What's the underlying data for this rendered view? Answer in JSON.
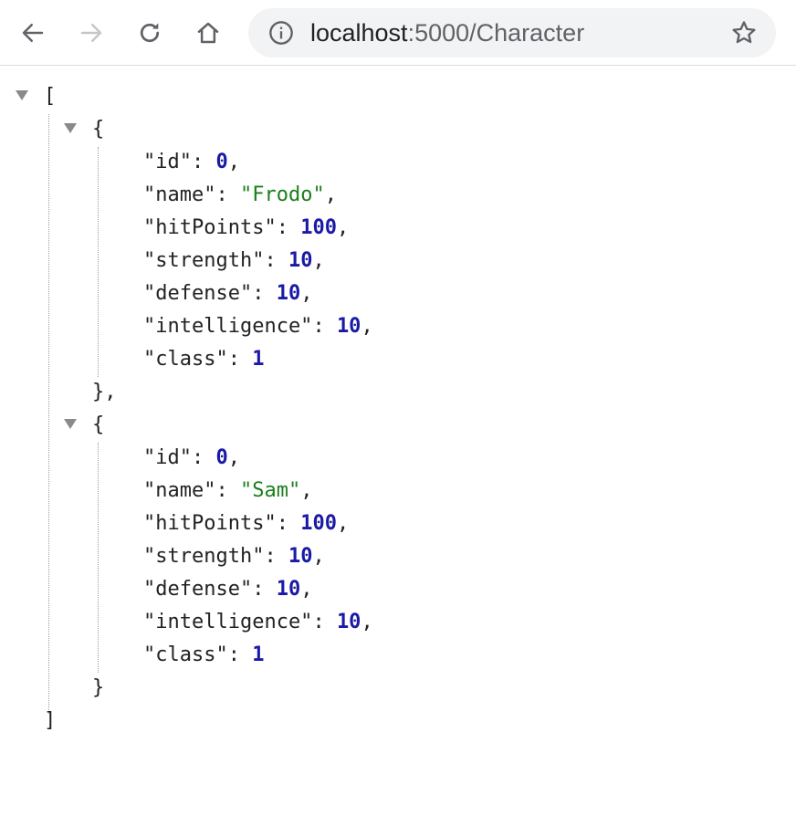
{
  "browser": {
    "url_host": "localhost",
    "url_rest": ":5000/Character",
    "icons": {
      "back": "arrow-left-icon",
      "forward": "arrow-right-icon",
      "reload": "reload-icon",
      "home": "home-icon",
      "info": "info-circle-icon",
      "bookmark": "star-outline-icon"
    }
  },
  "colors": {
    "string": "#1a7f1a",
    "number": "#1a1aa6",
    "punctuation": "#222222"
  },
  "json": {
    "open_bracket": "[",
    "close_bracket": "]",
    "characters": [
      {
        "open": "{",
        "close": "},",
        "fields": [
          {
            "key": "\"id\"",
            "val": "0",
            "type": "number",
            "sep": ","
          },
          {
            "key": "\"name\"",
            "val": "\"Frodo\"",
            "type": "string",
            "sep": ","
          },
          {
            "key": "\"hitPoints\"",
            "val": "100",
            "type": "number",
            "sep": ","
          },
          {
            "key": "\"strength\"",
            "val": "10",
            "type": "number",
            "sep": ","
          },
          {
            "key": "\"defense\"",
            "val": "10",
            "type": "number",
            "sep": ","
          },
          {
            "key": "\"intelligence\"",
            "val": "10",
            "type": "number",
            "sep": ","
          },
          {
            "key": "\"class\"",
            "val": "1",
            "type": "number",
            "sep": ""
          }
        ]
      },
      {
        "open": "{",
        "close": "}",
        "fields": [
          {
            "key": "\"id\"",
            "val": "0",
            "type": "number",
            "sep": ","
          },
          {
            "key": "\"name\"",
            "val": "\"Sam\"",
            "type": "string",
            "sep": ","
          },
          {
            "key": "\"hitPoints\"",
            "val": "100",
            "type": "number",
            "sep": ","
          },
          {
            "key": "\"strength\"",
            "val": "10",
            "type": "number",
            "sep": ","
          },
          {
            "key": "\"defense\"",
            "val": "10",
            "type": "number",
            "sep": ","
          },
          {
            "key": "\"intelligence\"",
            "val": "10",
            "type": "number",
            "sep": ","
          },
          {
            "key": "\"class\"",
            "val": "1",
            "type": "number",
            "sep": ""
          }
        ]
      }
    ]
  }
}
